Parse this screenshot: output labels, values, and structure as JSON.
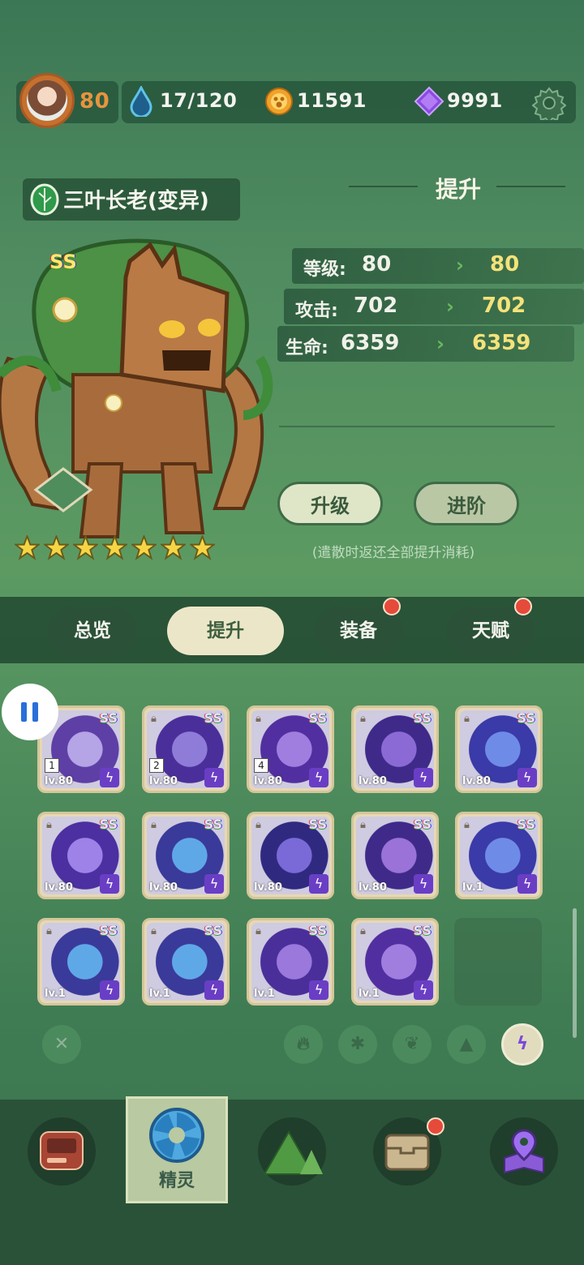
{
  "top_bar": {
    "player_level": "80",
    "energy": "17/120",
    "coins": "11591",
    "gems": "9991"
  },
  "spirit": {
    "name": "三叶长老(变异)",
    "rank": "SS",
    "stars": 7
  },
  "upgrade": {
    "title": "提升",
    "stats": [
      {
        "label": "等级:",
        "current": "80",
        "next": "80"
      },
      {
        "label": "攻击:",
        "current": "702",
        "next": "702"
      },
      {
        "label": "生命:",
        "current": "6359",
        "next": "6359"
      }
    ],
    "level_up_label": "升级",
    "advance_label": "进阶",
    "note": "(遣散时返还全部提升消耗)"
  },
  "tabs": [
    {
      "label": "总览",
      "active": false,
      "dot": false
    },
    {
      "label": "提升",
      "active": true,
      "dot": false
    },
    {
      "label": "装备",
      "active": false,
      "dot": true
    },
    {
      "label": "天赋",
      "active": false,
      "dot": true
    }
  ],
  "cards": [
    {
      "level": "lv.80",
      "rank": "SS",
      "num": "1"
    },
    {
      "level": "lv.80",
      "rank": "SS",
      "num": "2"
    },
    {
      "level": "lv.80",
      "rank": "SS",
      "num": "4"
    },
    {
      "level": "lv.80",
      "rank": "SS"
    },
    {
      "level": "lv.80",
      "rank": "SS"
    },
    {
      "level": "lv.80",
      "rank": "SS"
    },
    {
      "level": "lv.80",
      "rank": "SS"
    },
    {
      "level": "lv.80",
      "rank": "SS"
    },
    {
      "level": "lv.80",
      "rank": "SS"
    },
    {
      "level": "lv.1",
      "rank": "SS"
    },
    {
      "level": "lv.1",
      "rank": "SS"
    },
    {
      "level": "lv.1",
      "rank": "SS"
    },
    {
      "level": "lv.1",
      "rank": "SS"
    },
    {
      "level": "lv.1",
      "rank": "SS"
    }
  ],
  "bottom_nav": {
    "active_label": "精灵"
  },
  "colors": {
    "accent_gold": "#f5e27a",
    "accent_orange": "#e7943f",
    "red_dot": "#e54a3a"
  }
}
